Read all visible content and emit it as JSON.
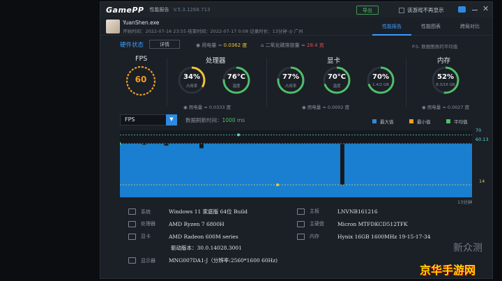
{
  "titlebar": {
    "logo": "GamePP",
    "title": "性能报告",
    "version": "V.5.3.1268.713",
    "export_label": "导出",
    "no_show_label": "该游戏不再显示"
  },
  "app": {
    "name": "YuanShen.exe",
    "meta": "开始时间：2022-07-16 23:55    结束时间：2022-07-17 0:08    记录时长：13分钟    ◎ 广州"
  },
  "tabs": [
    {
      "label": "性能报告",
      "active": true
    },
    {
      "label": "性能图表",
      "active": false
    },
    {
      "label": "跨局对比",
      "active": false
    }
  ],
  "hw_status": {
    "title": "硬件状态",
    "detail_label": "详情",
    "power_total_prefix": "用电量 ≈ ",
    "power_total": "0.0362 度",
    "co2_prefix": "二氧化碳排放量 ≈ ",
    "co2": "28.4 克",
    "note": "P.S. 数据图表的平均值"
  },
  "fps": {
    "label": "FPS",
    "value": "60"
  },
  "cpu": {
    "label": "处理器",
    "usage": "34%",
    "usage_sub": "占用率",
    "usage_frac": 0.34,
    "temp": "76°C",
    "temp_sub": "温度",
    "temp_frac": 0.76,
    "power": "用电量 ≈ 0.0333 度"
  },
  "gpu": {
    "label": "显卡",
    "usage": "77%",
    "usage_sub": "占用率",
    "usage_frac": 0.77,
    "temp": "70°C",
    "temp_sub": "温度",
    "temp_frac": 0.7,
    "mem": "70%",
    "mem_sub": "1.4/2 GB",
    "mem_frac": 0.7,
    "power": "用电量 ≈ 0.0002 度"
  },
  "memory": {
    "label": "内存",
    "usage": "52%",
    "usage_sub": "8.3/16 GB",
    "usage_frac": 0.52,
    "power": "用电量 ≈ 0.0027 度"
  },
  "chart_ctrl": {
    "metric": "FPS",
    "rate_prefix": "数据刷新时间：",
    "rate_value": "1000",
    "rate_unit": " ms"
  },
  "legend": [
    {
      "label": "最大值",
      "color": "#2e8ae0"
    },
    {
      "label": "最小值",
      "color": "#f0a021"
    },
    {
      "label": "平均值",
      "color": "#4fbf68"
    }
  ],
  "chart_data": {
    "type": "area",
    "series": [
      {
        "values": [
          60,
          60,
          60,
          60,
          60,
          59,
          60,
          60,
          60,
          60,
          58,
          60,
          60,
          60,
          60,
          60,
          60,
          60,
          55,
          60,
          60,
          60,
          60,
          60,
          60,
          60,
          60,
          60,
          60,
          60,
          60,
          60,
          60,
          60,
          60,
          60,
          60,
          60,
          60,
          60,
          60,
          60,
          60,
          60,
          60,
          60,
          60,
          60,
          60,
          60,
          14,
          60,
          60,
          60,
          60,
          60,
          60,
          60,
          60,
          60,
          60,
          60,
          60,
          60,
          60,
          60,
          60,
          60,
          60,
          60,
          60,
          60,
          60,
          60,
          60,
          60,
          60,
          60,
          60,
          60
        ]
      }
    ],
    "max": 70,
    "avg": 60.13,
    "min": 14,
    "x_label": "13分钟",
    "ylim": [
      0,
      75
    ]
  },
  "specs": {
    "system_label": "系统",
    "system": "Windows 11 家庭版 64位  Build",
    "cpu_label": "处理器",
    "cpu": "AMD Ryzen 7 6800H",
    "gpu_label": "显卡",
    "gpu": "AMD Radeon 600M series",
    "driver": "驱动版本：30.0.14028.3001",
    "display_label": "显示器",
    "display": "MNG007DA1-J（分辨率:2560*1600 60Hz)",
    "board_label": "主板",
    "board": "LNVNB161216",
    "disk_label": "主硬盘",
    "disk": "Micron MTFDKCD512TFK",
    "ram_label": "内存",
    "ram": "Hynix 16GB 1600MHz 19-15-17-34"
  },
  "watermark": {
    "top": "新众测",
    "bottom": "京华手游网"
  }
}
